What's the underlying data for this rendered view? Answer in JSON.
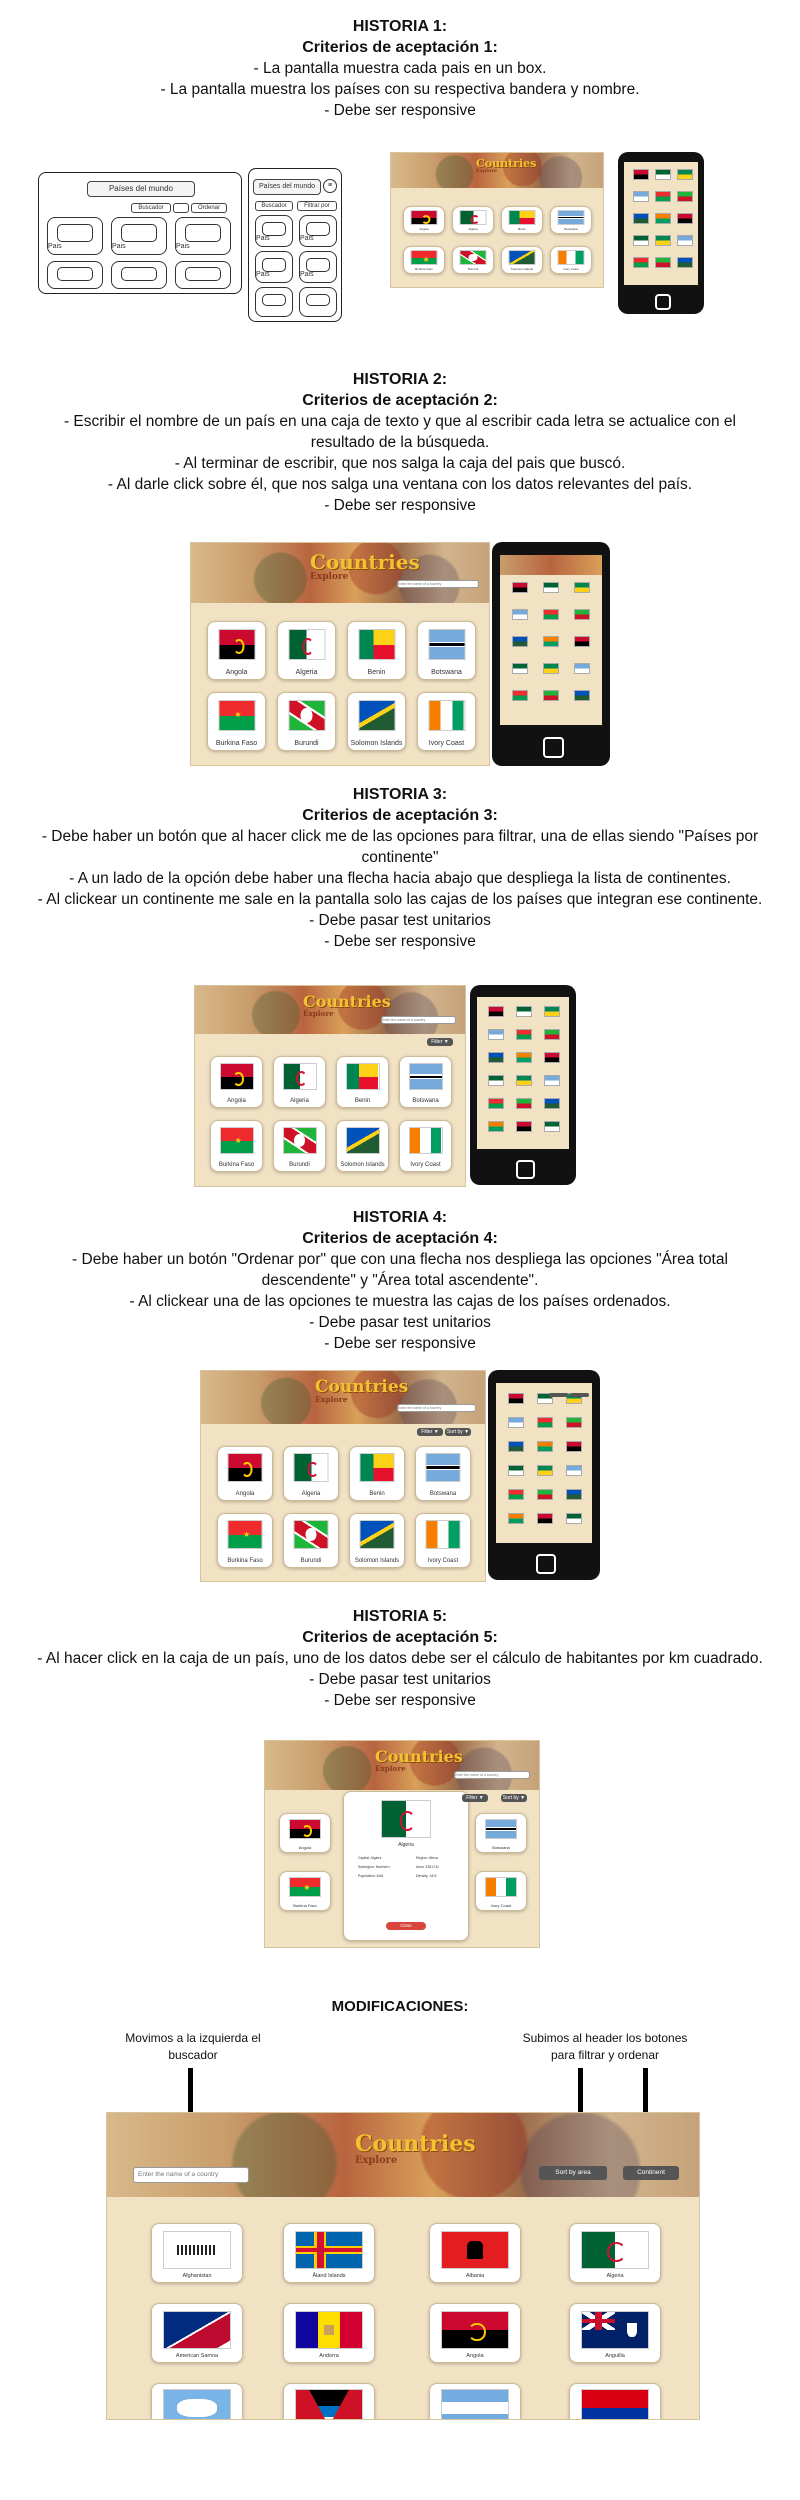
{
  "stories": [
    {
      "title": "HISTORIA 1:",
      "subtitle": "Criterios de aceptación 1:",
      "lines": [
        "- La pantalla muestra cada pais en un box.",
        "- La pantalla muestra los países con su respectiva bandera y nombre.",
        "- Debe ser responsive"
      ]
    },
    {
      "title": "HISTORIA 2:",
      "subtitle": "Criterios de aceptación 2:",
      "lines": [
        "- Escribir el nombre de un país  en una caja de texto y que al escribir cada letra se actualice con el",
        "resultado de la búsqueda.",
        "- Al terminar de escribir, que nos salga la caja del pais que buscó.",
        "- Al darle click sobre él, que nos salga una ventana con los datos relevantes del país.",
        "- Debe ser responsive"
      ]
    },
    {
      "title": "HISTORIA 3:",
      "subtitle": "Criterios de aceptación 3:",
      "lines": [
        "- Debe haber un botón que al hacer click me de las opciones para filtrar, una de ellas siendo \"Países por",
        "continente\"",
        "- A un lado de la opción debe haber una flecha hacia abajo que despliega la lista de continentes.",
        "- Al clickear un continente me sale en la pantalla solo las cajas de los países que integran ese continente.",
        "- Debe pasar test unitarios",
        "- Debe ser responsive"
      ]
    },
    {
      "title": "HISTORIA 4:",
      "subtitle": "Criterios de aceptación 4:",
      "lines": [
        "- Debe haber un botón \"Ordenar por\" que con una flecha nos despliega las opciones \"Área total",
        "descendente\" y \"Área total ascendente\".",
        "- Al clickear una de las opciones te muestra las cajas de los países ordenados.",
        "- Debe pasar test unitarios",
        "- Debe ser responsive"
      ]
    },
    {
      "title": "HISTORIA 5:",
      "subtitle": "Criterios de aceptación 5:",
      "lines": [
        "- Al hacer click en la caja de un país, uno de los datos debe ser el cálculo de habitantes por km cuadrado.",
        "- Debe pasar test unitarios",
        "- Debe ser responsive"
      ]
    }
  ],
  "wireframe": {
    "header": "Países del mundo",
    "search": "Buscador",
    "filter": "Filtrar por",
    "order": "Ordenar",
    "box_label": "Pais"
  },
  "app": {
    "logo": "Countries",
    "logo_sub": "Explore",
    "filter_btn": "Filter ▼",
    "sort_btn": "Sort by ▼",
    "search_placeholder": "Enter the name of a country",
    "sort_label": "Sort by area",
    "filter_label": "Continent"
  },
  "countries_small": [
    "Angola",
    "Algeria",
    "Benin",
    "Botswana",
    "Burkina Faso",
    "Burundi",
    "Solomon Islands",
    "Ivory Coast"
  ],
  "detail": {
    "name": "Algeria",
    "close": "Close",
    "rows": [
      "Capital: Algiers",
      "Region: Africa",
      "Subregion: Northern",
      "Area: 2381741",
      "Population: 44M",
      "Density: 18.5"
    ]
  },
  "modifications": {
    "title": "MODIFICACIONES:",
    "left_note": "Movimos a la izquierda el buscador",
    "right_note": "Subimos al header los botones para filtrar y ordenar",
    "countries": [
      "Afghanistan",
      "Åland Islands",
      "Albania",
      "Algeria",
      "American Samoa",
      "Andorra",
      "Angola",
      "Anguilla",
      "",
      "",
      "",
      ""
    ]
  },
  "colors": {
    "bg": "#f1e2c4",
    "gold": "#f2c230",
    "dark": "#111111"
  }
}
